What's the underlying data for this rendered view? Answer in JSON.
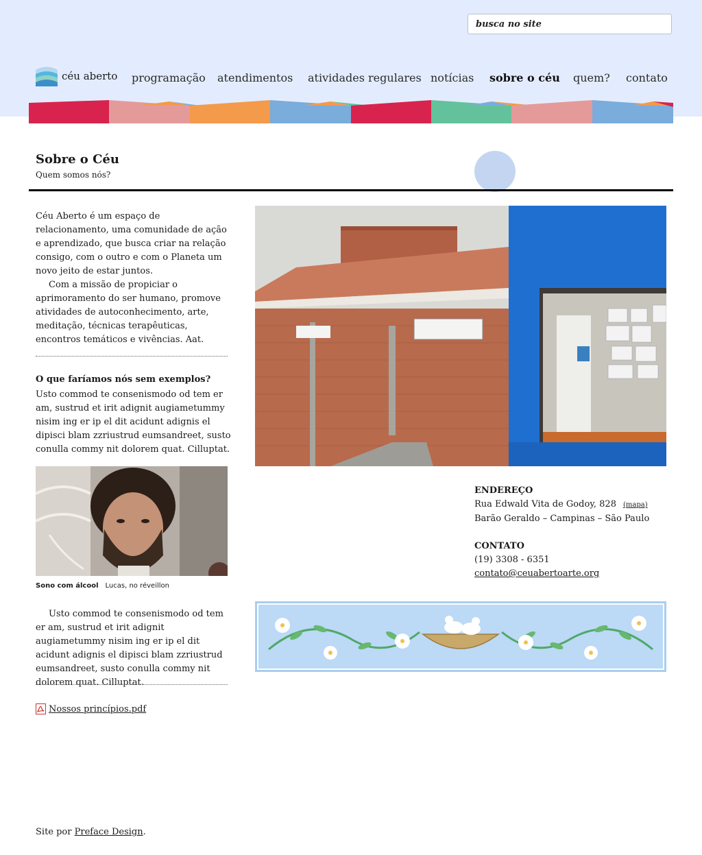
{
  "search": {
    "placeholder": "busca no site"
  },
  "brand": {
    "logo_text": "céu aberto"
  },
  "nav": {
    "items": [
      {
        "label": "programação"
      },
      {
        "label": "atendimentos"
      },
      {
        "label": "atividades regulares"
      },
      {
        "label": "notícias"
      },
      {
        "label": "sobre o céu",
        "active": true
      },
      {
        "label": "quem?"
      },
      {
        "label": "contato"
      }
    ]
  },
  "colors": {
    "header_bg": "#e3ecfe",
    "stripe": [
      "#d8234e",
      "#e59a9a",
      "#f49a4b",
      "#7aacdc",
      "#63c29b"
    ]
  },
  "page": {
    "title": "Sobre o Céu",
    "subtitle": "Quem somos nós?"
  },
  "intro": {
    "part1": "Céu Aberto é um espaço de relacionamento, uma comunidade de ação e aprendizado, que busca criar na relação consigo, com o outro e com o Planeta um novo jeito de estar juntos.",
    "part2": "Com a missão de propiciar o aprimoramento do ser humano, promove atividades de autoconhecimento, arte, meditação, técnicas terapêuticas, encontros temáticos e vivências. Aat."
  },
  "examples": {
    "title": "O que faríamos nós sem exemplos?",
    "text": "Usto commod te consenismodo od tem er am, sustrud et irit adignit augiametummy nisim ing er ip el dit acidunt adignis el dipisci blam zzriustrud eumsandreet, susto conulla commy nit dolorem quat. Cilluptat."
  },
  "caption": {
    "bold": "Sono com álcool",
    "text": "Lucas, no réveillon"
  },
  "body_text2": "Usto commod te consenismodo od tem er am, sustrud et irit adignit augiametummy nisim ing er ip el dit acidunt adignis el dipisci blam zzriustrud eumsandreet, susto conulla commy nit dolorem quat. Cilluptat.",
  "pdf": {
    "label": "Nossos princípios.pdf",
    "icon": "pdf-icon"
  },
  "address": {
    "label": "ENDEREÇO",
    "line1": "Rua Edwald Vita de Godoy, 828",
    "map_link": "(mapa)",
    "line2": "Barão Geraldo – Campinas – São Paulo"
  },
  "contact": {
    "label": "CONTATO",
    "phone": "(19) 3308 - 6351",
    "email": "contato@ceuabertoarte.org"
  },
  "footer": {
    "prefix": "Site por",
    "link": "Preface Design",
    "suffix": "."
  }
}
